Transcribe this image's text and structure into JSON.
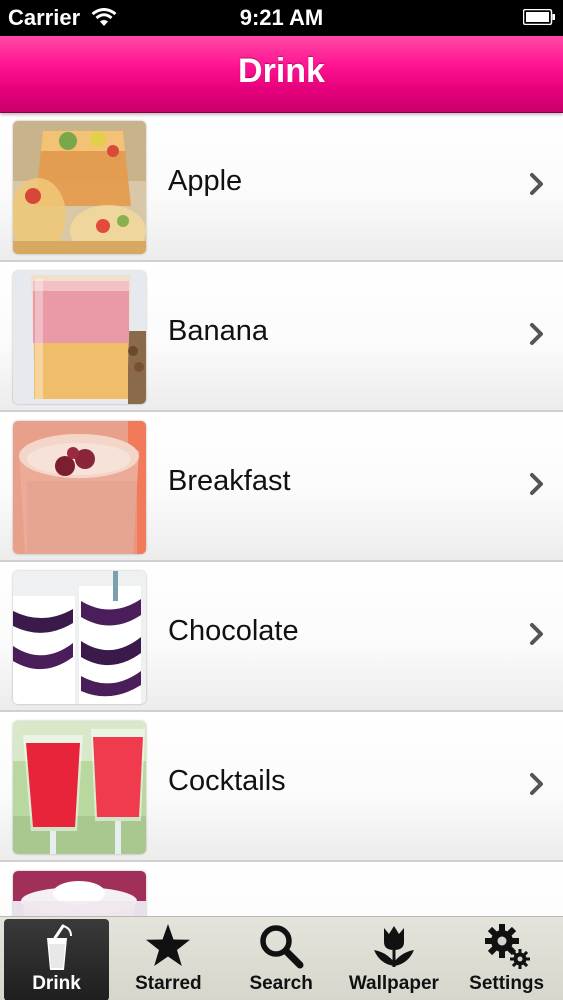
{
  "status_bar": {
    "carrier": "Carrier",
    "time": "9:21 AM"
  },
  "nav": {
    "title": "Drink"
  },
  "list": {
    "items": [
      {
        "label": "Apple",
        "icon": "apple-drink-thumbnail"
      },
      {
        "label": "Banana",
        "icon": "banana-smoothie-thumbnail"
      },
      {
        "label": "Breakfast",
        "icon": "breakfast-smoothie-thumbnail"
      },
      {
        "label": "Chocolate",
        "icon": "chocolate-milkshake-thumbnail"
      },
      {
        "label": "Cocktails",
        "icon": "cocktails-thumbnail"
      },
      {
        "label": "",
        "icon": "dessert-drink-thumbnail"
      }
    ]
  },
  "tab_bar": {
    "tabs": [
      {
        "label": "Drink",
        "icon": "drink-glass-icon",
        "active": true
      },
      {
        "label": "Starred",
        "icon": "star-icon"
      },
      {
        "label": "Search",
        "icon": "magnifier-icon"
      },
      {
        "label": "Wallpaper",
        "icon": "tulip-icon"
      },
      {
        "label": "Settings",
        "icon": "gears-icon"
      }
    ]
  },
  "colors": {
    "nav_pink": "#ff1493",
    "tab_bar_bg": "#d6d6cc",
    "active_tab_bg": "#2a2a2a"
  }
}
